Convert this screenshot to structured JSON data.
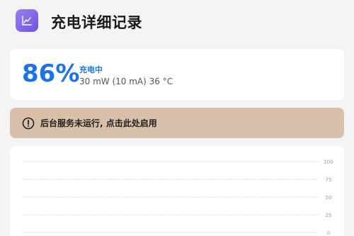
{
  "header": {
    "icon": "line-chart-icon",
    "title": "充电详细记录"
  },
  "status": {
    "percent": "86%",
    "label": "充电中",
    "detail": "30 mW (10 mA) 36 °C",
    "accent_color": "#1a73e8"
  },
  "warning": {
    "icon": "alert-circle-icon",
    "text": "后台服务未运行, 点击此处启用",
    "background_color": "#d7bfaa"
  },
  "chart_data": {
    "type": "line",
    "y_ticks": [
      "100",
      "75",
      "50",
      "25",
      "0"
    ],
    "ylim": [
      0,
      100
    ],
    "grid": true,
    "series": []
  }
}
